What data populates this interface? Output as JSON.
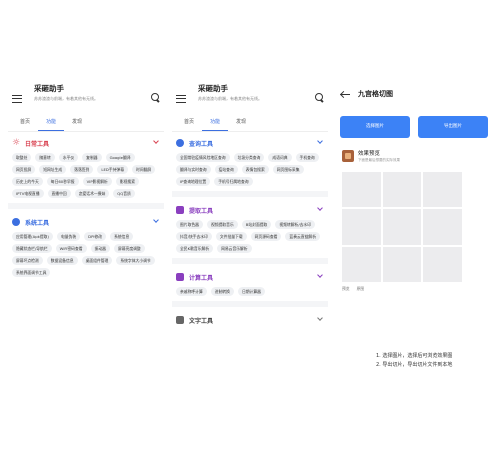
{
  "left_panel": {
    "app_title": "采砸助手",
    "app_subtitle": "苏苏渣渣与前端，有着其他有无线。",
    "tabs": [
      {
        "label": "首页",
        "active": false
      },
      {
        "label": "功能",
        "active": true
      },
      {
        "label": "发现",
        "active": false
      }
    ],
    "sections": [
      {
        "title": "日常工具",
        "icon": "sun-icon",
        "color": "#d94452",
        "items": [
          "取整处",
          "随意转",
          "水平仪",
          "复制器",
          "Google翻译",
          "网页投屏",
          "短网址生成",
          "落落签到",
          "LED手持弹幕",
          "时间翻屏",
          "历史上的今天",
          "每日60秒早报",
          "VIP影视解析",
          "影视搜索",
          "IPTV电视直播",
          "直播中回",
          "恋爱话术一撩妹",
          "QQ音质"
        ]
      },
      {
        "title": "系统工具",
        "icon": "globe-icon",
        "color": "#3c6fe0",
        "items": [
          "应用管理(Apk提取)",
          "电量伪装",
          "DPI修改",
          "系统信息",
          "隐藏状态栏/导航栏",
          "WiFi密码查看",
          "振动器",
          "屏幕亮度调整",
          "屏幕坏点检测",
          "数据设备信息",
          "桌面组件管理",
          "系统字体大小调节",
          "系统界面调节工具"
        ]
      }
    ]
  },
  "middle_panel": {
    "app_title": "采砸助手",
    "app_subtitle": "苏苏渣渣与前端，有着其他有无线。",
    "tabs": [
      {
        "label": "首页",
        "active": false
      },
      {
        "label": "功能",
        "active": true
      },
      {
        "label": "发现",
        "active": false
      }
    ],
    "sections": [
      {
        "title": "查询工具",
        "icon": "globe-icon",
        "color": "#3c6fe0",
        "items": [
          "全国常驻疫情风险地区查询",
          "垃圾分类查询",
          "成语词典",
          "手机查询",
          "翻译与实时查询",
          "疫站查询",
          "表情包搜索",
          "网页图标采集",
          "IP查询地理位置",
          "手机号归属地查询"
        ]
      },
      {
        "title": "提取工具",
        "icon": "image-icon",
        "color": "#8a3fbf",
        "items": [
          "图片取色器",
          "视频提取音乐",
          "B站封面提取",
          "视频转解析/去水印",
          "抖音/快手去水印",
          "文件批量下载",
          "网页源码查看",
          "蓝奏云直链解析",
          "全民K歌音乐解析",
          "网易云音乐解析"
        ]
      },
      {
        "title": "计算工具",
        "icon": "calculator-icon",
        "color": "#8a3fbf",
        "items": [
          "亲戚称呼计算",
          "进制转换",
          "日期计算器"
        ]
      },
      {
        "title": "文字工具",
        "icon": "text-icon",
        "color": "#444444",
        "items": []
      }
    ]
  },
  "right_panel": {
    "title": "九宫格切图",
    "select_button": "选择图片",
    "export_button": "导出图片",
    "preview_title": "效果预览",
    "preview_subtitle": "下面是最后想要的实际效果",
    "preview_links": [
      "预览",
      "原图"
    ],
    "instructions": [
      "1. 选择图片，选择后可浏览效果图",
      "2. 导出切片，导出切片文件到本地"
    ]
  },
  "colors": {
    "accent_blue": "#3c82f6",
    "red_section": "#d94452",
    "purple_section": "#8a3fbf"
  }
}
